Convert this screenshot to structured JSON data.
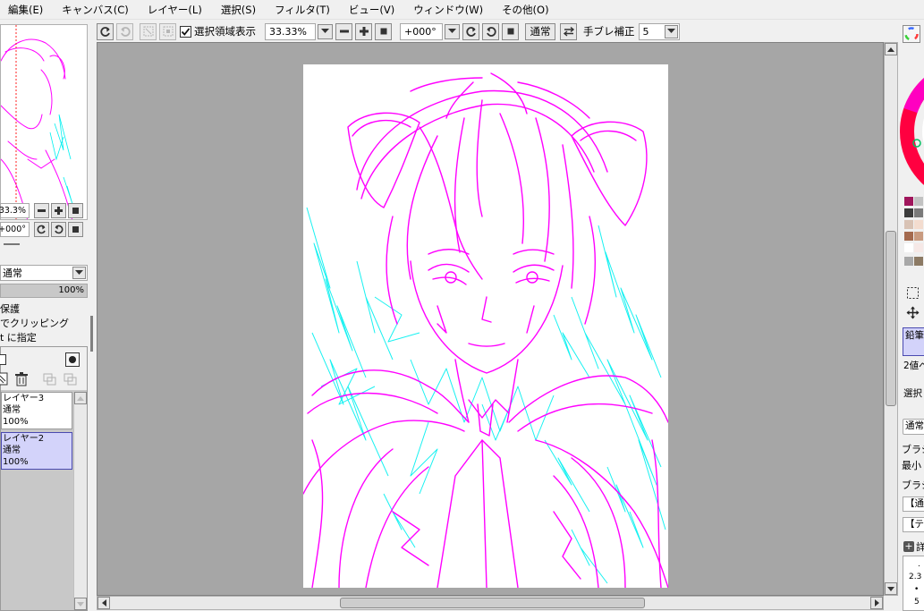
{
  "menu": {
    "items": [
      "編集(E)",
      "キャンバス(C)",
      "レイヤー(L)",
      "選択(S)",
      "フィルタ(T)",
      "ビュー(V)",
      "ウィンドウ(W)",
      "その他(O)"
    ]
  },
  "toolbar": {
    "selection_visible_label": "選択領域表示",
    "selection_visible_checked": true,
    "zoom_value": "33.33%",
    "rotation_value": "+000°",
    "blend_mode_button": "通常",
    "stabilizer_label": "手ブレ補正",
    "stabilizer_value": "5"
  },
  "navigator": {
    "zoom_value": "33.3%",
    "rotation_value": "+000°"
  },
  "layer_panel": {
    "blend_mode": "通常",
    "opacity": "100%",
    "options": [
      "保護",
      "でクリッピング",
      "t に指定"
    ],
    "layers": [
      {
        "name": "レイヤー3",
        "mode": "通常",
        "opacity": "100%",
        "selected": false
      },
      {
        "name": "レイヤー2",
        "mode": "通常",
        "opacity": "100%",
        "selected": true
      }
    ]
  },
  "right_panel": {
    "tool_items": [
      "鉛筆",
      "2値ペ",
      "選択"
    ],
    "blend_mode": "通常",
    "brush_labels": [
      "ブラシ",
      "最小",
      "ブラシ"
    ],
    "brush_boxes": [
      "【通",
      "【テ"
    ],
    "detail_label": "詳",
    "size_values": [
      ".",
      "2.3",
      "•",
      "5"
    ]
  },
  "colors": {
    "swatches": [
      "#a0165c",
      "#c2c2c2",
      "#3c3c3c",
      "#7a7a7a",
      "#d8c2b4",
      "#f3dccf",
      "#a46a4e",
      "#c99b80",
      "#ffffff",
      "#f6e8e6",
      "#a8a8a8",
      "#8c7a64"
    ],
    "sketch_magenta": "#ff00ff",
    "sketch_cyan": "#00f0f0",
    "canvas_bg": "#a6a6a6",
    "selected_layer": "#d3d3fa"
  }
}
